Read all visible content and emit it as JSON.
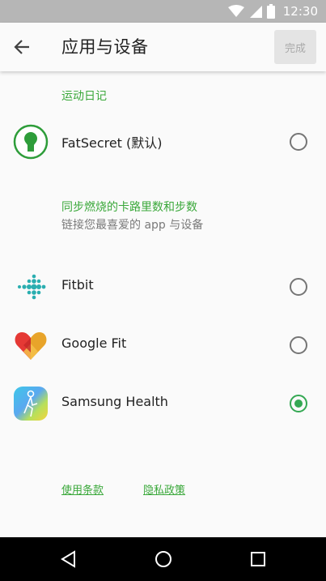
{
  "status_bar": {
    "time": "12:30",
    "icons": [
      "wifi-icon",
      "signal-icon",
      "battery-icon"
    ]
  },
  "app_bar": {
    "title": "应用与设备",
    "done_label": "完成",
    "back_icon": "arrow-back-icon"
  },
  "diary_section": {
    "label": "运动日记",
    "items": [
      {
        "label": "FatSecret (默认)",
        "icon": "fatsecret-logo-icon",
        "selected": false
      }
    ]
  },
  "sync_section": {
    "title": "同步燃烧的卡路里数和步数",
    "subtitle": "链接您最喜爱的 app 与设备",
    "items": [
      {
        "label": "Fitbit",
        "icon": "fitbit-logo-icon",
        "selected": false
      },
      {
        "label": "Google Fit",
        "icon": "google-fit-logo-icon",
        "selected": false
      },
      {
        "label": "Samsung Health",
        "icon": "samsung-health-logo-icon",
        "selected": true
      }
    ]
  },
  "footer": {
    "terms_label": "使用条款",
    "privacy_label": "隐私政策"
  },
  "colors": {
    "accent_green": "#3aa83a",
    "radio_checked": "#34a853",
    "status_bar": "#b6b6b6",
    "nav_bar": "#000000"
  },
  "nav_bar": {
    "buttons": [
      "back-triangle-icon",
      "home-circle-icon",
      "recents-square-icon"
    ]
  }
}
